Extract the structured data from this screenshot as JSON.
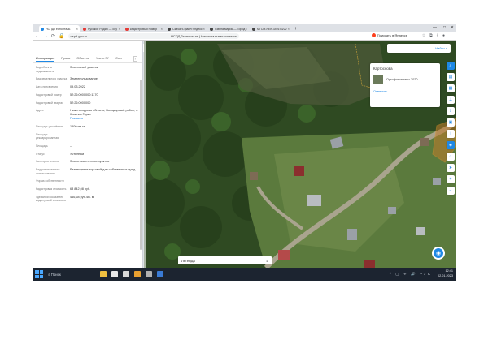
{
  "browser": {
    "tabs": [
      {
        "label": "НСПД Геопорталь",
        "active": true,
        "color": "#1e88e5"
      },
      {
        "label": "Русское Радио — слу",
        "active": false,
        "color": "#e53935"
      },
      {
        "label": "кадастровый номер",
        "active": false,
        "color": "#e53935"
      },
      {
        "label": "Скачать файл Яндекс",
        "active": false,
        "color": "#444444"
      },
      {
        "label": "Смена марок — Город",
        "active": false,
        "color": "#444444"
      },
      {
        "label": "МГСМ-РЕК-349193/22",
        "active": false,
        "color": "#444444"
      }
    ],
    "url": "nspd.gov.ru",
    "page_title": "НСПД Геопорталь | Национальная система",
    "yandex_search": "Поискать в Яндексе",
    "window_controls": [
      "—",
      "□",
      "✕"
    ]
  },
  "panel": {
    "tabs": [
      "Информация",
      "Права",
      "Объекты",
      "Части ЗУ",
      "Сост"
    ],
    "active_tab": 0,
    "properties": [
      {
        "label": "Вид объекта недвижимости",
        "value": "Земельный участок"
      },
      {
        "label": "Вид земельного участка",
        "value": "Землепользование"
      },
      {
        "label": "Дата присвоения",
        "value": "09.03.2022"
      },
      {
        "label": "Кадастровый номер",
        "value": "52:26:0000000:1170"
      },
      {
        "label": "Кадастровый квартал",
        "value": "52:26:0000000"
      },
      {
        "label": "Адрес",
        "value": "Нижегородская область, Володарский район, п. Красная Горка",
        "link": "Показать"
      },
      {
        "label": "Площадь уточнённая",
        "value": "1500 кв. м"
      },
      {
        "label": "Площадь декларированная",
        "value": "–"
      },
      {
        "label": "Площадь",
        "value": "–"
      },
      {
        "label": "Статус",
        "value": "Учтенный"
      },
      {
        "label": "Категория земель",
        "value": "Земли населенных пунктов"
      },
      {
        "label": "Вид разрешенного использования",
        "value": "Размещение торговой для собственных нужд"
      },
      {
        "label": "Форма собственности",
        "value": ""
      },
      {
        "label": "Кадастровая стоимость",
        "value": "68 842,08 руб."
      },
      {
        "label": "Удельный показатель кадастровой стоимости",
        "value": "446,68 руб./кв. м"
      }
    ]
  },
  "map": {
    "search_label": "Найти",
    "basemap_popup": {
      "title": "Картоснова",
      "item_label": "Ортофотопланы 2020",
      "link_label": "Отменить"
    },
    "legend_label": "Легенда"
  },
  "taskbar": {
    "search_placeholder": "Поиск",
    "tray_icons": "^ ▢ ᯤ 🔊 РУС",
    "time": "12:41",
    "date": "02.01.2023",
    "taskbar_icon_colors": [
      "#f0c040",
      "#e8e8e8",
      "#d9d9d9",
      "#e8a030",
      "#b0b0b0",
      "#3a7bd5"
    ]
  }
}
